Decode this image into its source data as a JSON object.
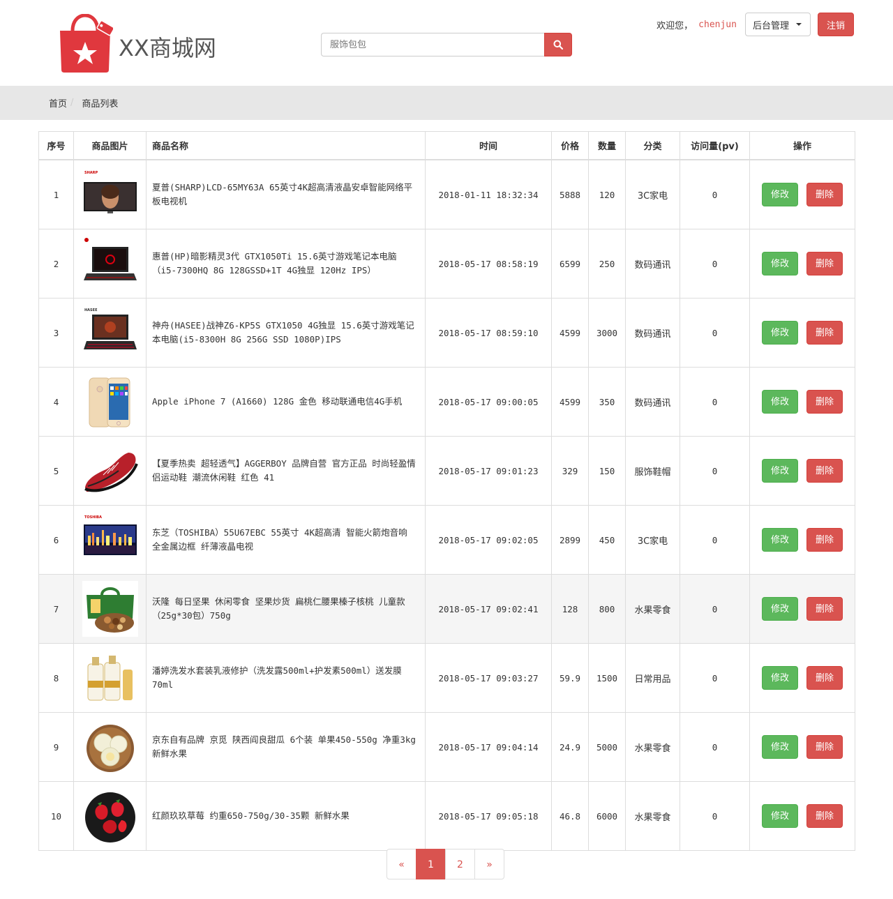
{
  "header": {
    "site_name": "XX商城网",
    "search_placeholder": "服饰包包",
    "search_value": "",
    "welcome": "欢迎您，",
    "username": "chenjun",
    "admin_menu": "后台管理",
    "logout": "注销"
  },
  "breadcrumb": {
    "home": "首页",
    "current": "商品列表"
  },
  "table": {
    "headers": {
      "index": "序号",
      "image": "商品图片",
      "name": "商品名称",
      "time": "时间",
      "price": "价格",
      "qty": "数量",
      "category": "分类",
      "pv": "访问量(pv)",
      "ops": "操作"
    },
    "rows": [
      {
        "index": "1",
        "image": "sharp-tv-image",
        "name": "夏普(SHARP)LCD-65MY63A 65英寸4K超高清液晶安卓智能网络平板电视机",
        "time": "2018-01-11 18:32:34",
        "price": "5888",
        "qty": "120",
        "category": "3C家电",
        "pv": "0",
        "edit": "修改",
        "del": "删除"
      },
      {
        "index": "2",
        "image": "hp-laptop-image",
        "name": "惠普(HP)暗影精灵3代 GTX1050Ti 15.6英寸游戏笔记本电脑（i5-7300HQ 8G 128GSSD+1T 4G独显 120Hz IPS）",
        "time": "2018-05-17 08:58:19",
        "price": "6599",
        "qty": "250",
        "category": "数码通讯",
        "pv": "0",
        "edit": "修改",
        "del": "删除"
      },
      {
        "index": "3",
        "image": "hasee-laptop-image",
        "name": "神舟(HASEE)战神Z6-KP5S GTX1050 4G独显 15.6英寸游戏笔记本电脑(i5-8300H 8G 256G SSD 1080P)IPS",
        "time": "2018-05-17 08:59:10",
        "price": "4599",
        "qty": "3000",
        "category": "数码通讯",
        "pv": "0",
        "edit": "修改",
        "del": "删除"
      },
      {
        "index": "4",
        "image": "iphone-image",
        "name": "Apple iPhone 7 (A1660) 128G 金色 移动联通电信4G手机",
        "time": "2018-05-17 09:00:05",
        "price": "4599",
        "qty": "350",
        "category": "数码通讯",
        "pv": "0",
        "edit": "修改",
        "del": "删除"
      },
      {
        "index": "5",
        "image": "sneaker-image",
        "name": "【夏季热卖 超轻透气】AGGERBOY 品牌自营 官方正品 时尚轻盈情侣运动鞋 潮流休闲鞋 红色 41",
        "time": "2018-05-17 09:01:23",
        "price": "329",
        "qty": "150",
        "category": "服饰鞋帽",
        "pv": "0",
        "edit": "修改",
        "del": "删除"
      },
      {
        "index": "6",
        "image": "toshiba-tv-image",
        "name": "东芝（TOSHIBA）55U67EBC 55英寸 4K超高清 智能火箭炮音响 全金属边框 纤薄液晶电视",
        "time": "2018-05-17 09:02:05",
        "price": "2899",
        "qty": "450",
        "category": "3C家电",
        "pv": "0",
        "edit": "修改",
        "del": "删除"
      },
      {
        "index": "7",
        "image": "nuts-image",
        "name": "沃隆 每日坚果 休闲零食 坚果炒货 扁桃仁腰果榛子核桃 儿童款（25g*30包）750g",
        "time": "2018-05-17 09:02:41",
        "price": "128",
        "qty": "800",
        "category": "水果零食",
        "pv": "0",
        "edit": "修改",
        "del": "删除"
      },
      {
        "index": "8",
        "image": "shampoo-image",
        "name": "潘婷洗发水套装乳液修护（洗发露500ml+护发素500ml）送发膜70ml",
        "time": "2018-05-17 09:03:27",
        "price": "59.9",
        "qty": "1500",
        "category": "日常用品",
        "pv": "0",
        "edit": "修改",
        "del": "删除"
      },
      {
        "index": "9",
        "image": "melon-image",
        "name": "京东自有品牌 京觅 陕西阎良甜瓜 6个装 单果450-550g 净重3kg 新鲜水果",
        "time": "2018-05-17 09:04:14",
        "price": "24.9",
        "qty": "5000",
        "category": "水果零食",
        "pv": "0",
        "edit": "修改",
        "del": "删除"
      },
      {
        "index": "10",
        "image": "strawberry-image",
        "name": "红颜玖玖草莓 约重650-750g/30-35颗 新鲜水果",
        "time": "2018-05-17 09:05:18",
        "price": "46.8",
        "qty": "6000",
        "category": "水果零食",
        "pv": "0",
        "edit": "修改",
        "del": "删除"
      }
    ]
  },
  "pagination": {
    "prev": "«",
    "pages": [
      "1",
      "2"
    ],
    "next": "»",
    "active": "1"
  },
  "colors": {
    "brand": "#e0383e",
    "danger": "#d9534f",
    "success": "#5cb85c"
  }
}
